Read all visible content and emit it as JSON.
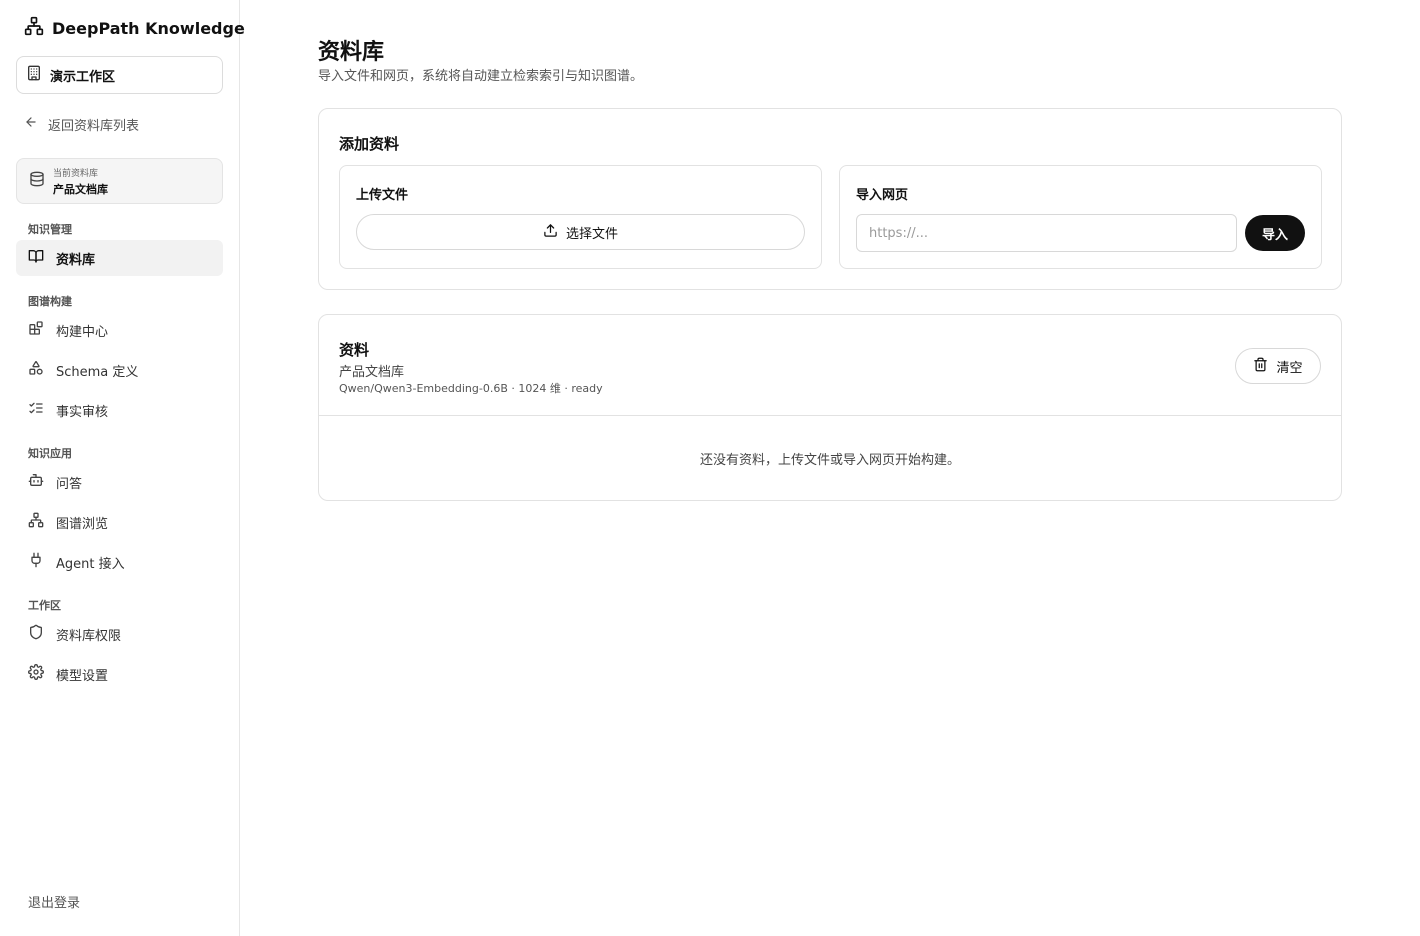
{
  "sidebar": {
    "brand": "DeepPath Knowledge",
    "workspace": "演示工作区",
    "back_link": "返回资料库列表",
    "current_library": {
      "caption": "当前资料库",
      "name": "产品文档库"
    },
    "sections": [
      {
        "title": "知识管理",
        "items": [
          {
            "label": "资料库",
            "icon": "book-open-icon",
            "active": true
          }
        ]
      },
      {
        "title": "图谱构建",
        "items": [
          {
            "label": "构建中心",
            "icon": "blocks-icon"
          },
          {
            "label": "Schema 定义",
            "icon": "shapes-icon"
          },
          {
            "label": "事实审核",
            "icon": "list-checks-icon"
          }
        ]
      },
      {
        "title": "知识应用",
        "items": [
          {
            "label": "问答",
            "icon": "bot-icon"
          },
          {
            "label": "图谱浏览",
            "icon": "network-icon"
          },
          {
            "label": "Agent 接入",
            "icon": "plug-icon"
          }
        ]
      },
      {
        "title": "工作区",
        "items": [
          {
            "label": "资料库权限",
            "icon": "shield-icon"
          },
          {
            "label": "模型设置",
            "icon": "gear-icon"
          }
        ]
      }
    ],
    "logout": "退出登录"
  },
  "main": {
    "title": "资料库",
    "subtitle": "导入文件和网页，系统将自动建立检索索引与知识图谱。",
    "add_card": {
      "title": "添加资料",
      "upload": {
        "title": "上传文件",
        "button": "选择文件"
      },
      "web": {
        "title": "导入网页",
        "placeholder": "https://...",
        "value": "",
        "button": "导入"
      }
    },
    "list_card": {
      "title": "资料",
      "library": "产品文档库",
      "meta": "Qwen/Qwen3-Embedding-0.6B · 1024 维 · ready",
      "clear_button": "清空",
      "empty": "还没有资料，上传文件或导入网页开始构建。"
    }
  }
}
